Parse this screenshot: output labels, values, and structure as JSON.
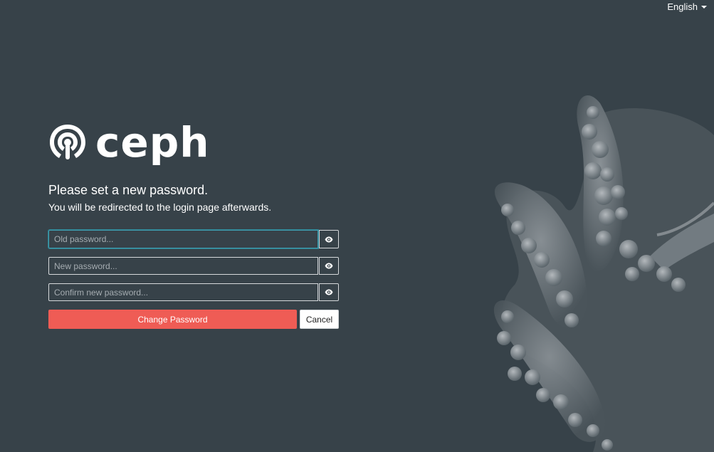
{
  "language": {
    "selected": "English"
  },
  "brand": {
    "name": "ceph"
  },
  "heading": {
    "title": "Please set a new password.",
    "subtitle": "You will be redirected to the login page afterwards."
  },
  "form": {
    "old_password": {
      "placeholder": "Old password...",
      "value": ""
    },
    "new_password": {
      "placeholder": "New password...",
      "value": ""
    },
    "confirm_password": {
      "placeholder": "Confirm new password...",
      "value": ""
    },
    "submit_label": "Change Password",
    "cancel_label": "Cancel"
  },
  "colors": {
    "background": "#374249",
    "primary_button": "#ef5c55",
    "focus_ring": "#3f9fb1"
  },
  "icons": {
    "toggle_visibility": "eye-icon",
    "language_caret": "caret-down-icon"
  }
}
